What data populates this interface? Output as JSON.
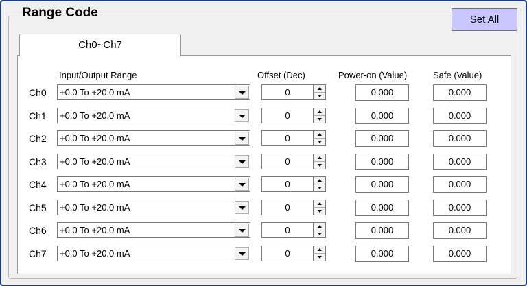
{
  "group_title": "Range Code",
  "set_all_label": "Set All",
  "tab_label": "Ch0~Ch7",
  "headers": {
    "range": "Input/Output Range",
    "offset": "Offset (Dec)",
    "power_on": "Power-on (Value)",
    "safe": "Safe (Value)"
  },
  "colors": {
    "frame": "#1f3b73",
    "set_all_bg": "#c9c7ff",
    "panel_bg": "#ffffff"
  },
  "channels": [
    {
      "label": "Ch0",
      "range": "+0.0 To +20.0 mA",
      "offset": "0",
      "power_on": "0.000",
      "safe": "0.000"
    },
    {
      "label": "Ch1",
      "range": "+0.0 To +20.0 mA",
      "offset": "0",
      "power_on": "0.000",
      "safe": "0.000"
    },
    {
      "label": "Ch2",
      "range": "+0.0 To +20.0 mA",
      "offset": "0",
      "power_on": "0.000",
      "safe": "0.000"
    },
    {
      "label": "Ch3",
      "range": "+0.0 To +20.0 mA",
      "offset": "0",
      "power_on": "0.000",
      "safe": "0.000"
    },
    {
      "label": "Ch4",
      "range": "+0.0 To +20.0 mA",
      "offset": "0",
      "power_on": "0.000",
      "safe": "0.000"
    },
    {
      "label": "Ch5",
      "range": "+0.0 To +20.0 mA",
      "offset": "0",
      "power_on": "0.000",
      "safe": "0.000"
    },
    {
      "label": "Ch6",
      "range": "+0.0 To +20.0 mA",
      "offset": "0",
      "power_on": "0.000",
      "safe": "0.000"
    },
    {
      "label": "Ch7",
      "range": "+0.0 To +20.0 mA",
      "offset": "0",
      "power_on": "0.000",
      "safe": "0.000"
    }
  ]
}
